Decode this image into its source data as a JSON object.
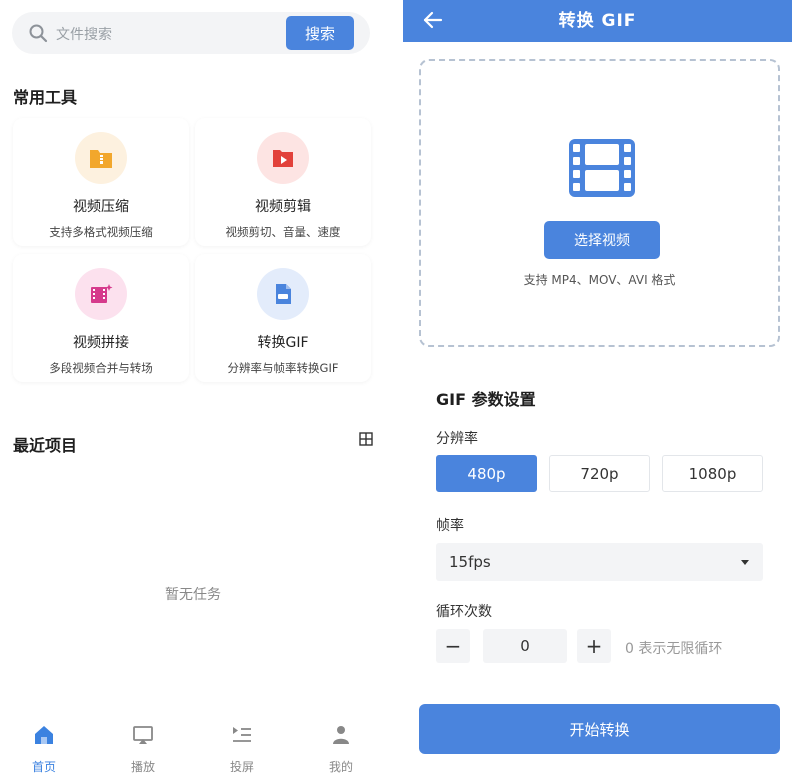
{
  "colors": {
    "accent": "#4a84dd",
    "active_tab": "#3b82e0",
    "text_muted": "#888888"
  },
  "home": {
    "search": {
      "placeholder": "文件搜索",
      "button_label": "搜索"
    },
    "tools_title": "常用工具",
    "tools": [
      {
        "title": "视频压缩",
        "desc": "支持多格式视频压缩",
        "icon": "folder-zip-icon",
        "icon_color": "#f2a72c",
        "circle_bg": "#fdf1df"
      },
      {
        "title": "视频剪辑",
        "desc": "视频剪切、音量、速度",
        "icon": "video-play-icon",
        "icon_color": "#e2413b",
        "circle_bg": "#fde4e3"
      },
      {
        "title": "视频拼接",
        "desc": "多段视频合并与转场",
        "icon": "film-sparkle-icon",
        "icon_color": "#d63a8c",
        "circle_bg": "#fce1ee"
      },
      {
        "title": "转换GIF",
        "desc": "分辨率与帧率转换GIF",
        "icon": "gif-file-icon",
        "icon_color": "#4a84dd",
        "circle_bg": "#e3ecfb"
      }
    ],
    "recent_title": "最近项目",
    "empty_text": "暂无任务",
    "tabs": [
      {
        "label": "首页",
        "icon": "home-icon",
        "active": true
      },
      {
        "label": "播放",
        "icon": "screen-play-icon",
        "active": false
      },
      {
        "label": "投屏",
        "icon": "cast-list-icon",
        "active": false
      },
      {
        "label": "我的",
        "icon": "user-icon",
        "active": false
      }
    ]
  },
  "gif": {
    "header_title": "转换 GIF",
    "select_button": "选择视频",
    "format_hint": "支持 MP4、MOV、AVI 格式",
    "settings_title": "GIF 参数设置",
    "resolution_label": "分辨率",
    "resolutions": [
      "480p",
      "720p",
      "1080p"
    ],
    "selected_resolution": "480p",
    "fps_label": "帧率",
    "fps_value": "15fps",
    "loop_label": "循环次数",
    "loop_minus": "−",
    "loop_plus": "+",
    "loop_value": "0",
    "loop_hint": "0 表示无限循环",
    "start_button": "开始转换"
  }
}
